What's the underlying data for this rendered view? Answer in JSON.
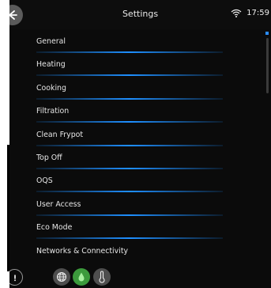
{
  "header": {
    "title": "Settings",
    "time": "17:59"
  },
  "menu": {
    "items": [
      {
        "label": "General"
      },
      {
        "label": "Heating"
      },
      {
        "label": "Cooking"
      },
      {
        "label": "Filtration"
      },
      {
        "label": "Clean Frypot"
      },
      {
        "label": "Top Off"
      },
      {
        "label": "OQS"
      },
      {
        "label": "User Access"
      },
      {
        "label": "Eco Mode"
      },
      {
        "label": "Networks & Connectivity"
      }
    ]
  },
  "icons": {
    "back": "back-arrow-icon",
    "wifi": "wifi-icon",
    "info": "info-icon",
    "globe": "globe-icon",
    "oil_drop": "oil-drop-icon",
    "thermometer": "thermometer-icon"
  },
  "colors": {
    "accent": "#1e8fff",
    "status_ok": "#3c9a3c"
  }
}
